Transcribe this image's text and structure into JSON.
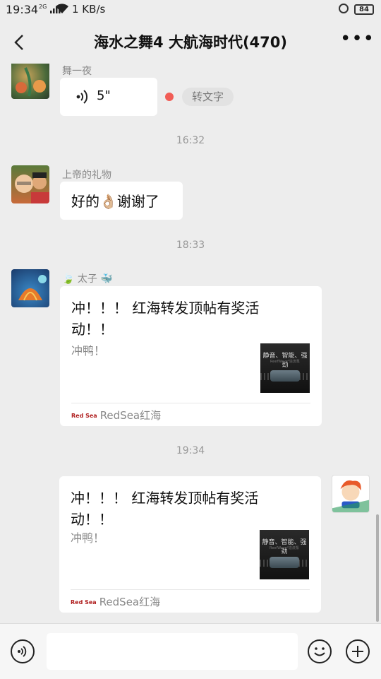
{
  "status_bar": {
    "time": "19:34",
    "signal": "2G",
    "network_speed": "1 KB/s",
    "battery": "84"
  },
  "header": {
    "title": "海水之舞4 大航海时代(470)"
  },
  "messages": [
    {
      "sender": "舞一夜",
      "voice_length": "5\"",
      "convert_label": "转文字"
    },
    {
      "timestamp": "16:32"
    },
    {
      "sender": "上帝的礼物",
      "text": "好的👌🏼谢谢了"
    },
    {
      "timestamp": "18:33"
    },
    {
      "sender": "🍃 太子 🐳",
      "card_title": "冲！！！ 红海转发顶帖有奖活动！！",
      "card_desc": "冲鸭！",
      "card_source": "RedSea红海",
      "thumb_text": "静音、智能、强劲",
      "thumb_sub": "ReefWave²造流泵"
    },
    {
      "timestamp": "19:34"
    },
    {
      "card_title": "冲！！！ 红海转发顶帖有奖活动！！",
      "card_desc": "冲鸭！",
      "card_source": "RedSea红海",
      "thumb_text": "静音、智能、强劲",
      "thumb_sub": "ReefWave²造流泵"
    }
  ],
  "logo_small": "Red Sea",
  "colors": {
    "background": "#ededed",
    "bubble": "#ffffff",
    "unread_dot": "#f15d56"
  }
}
